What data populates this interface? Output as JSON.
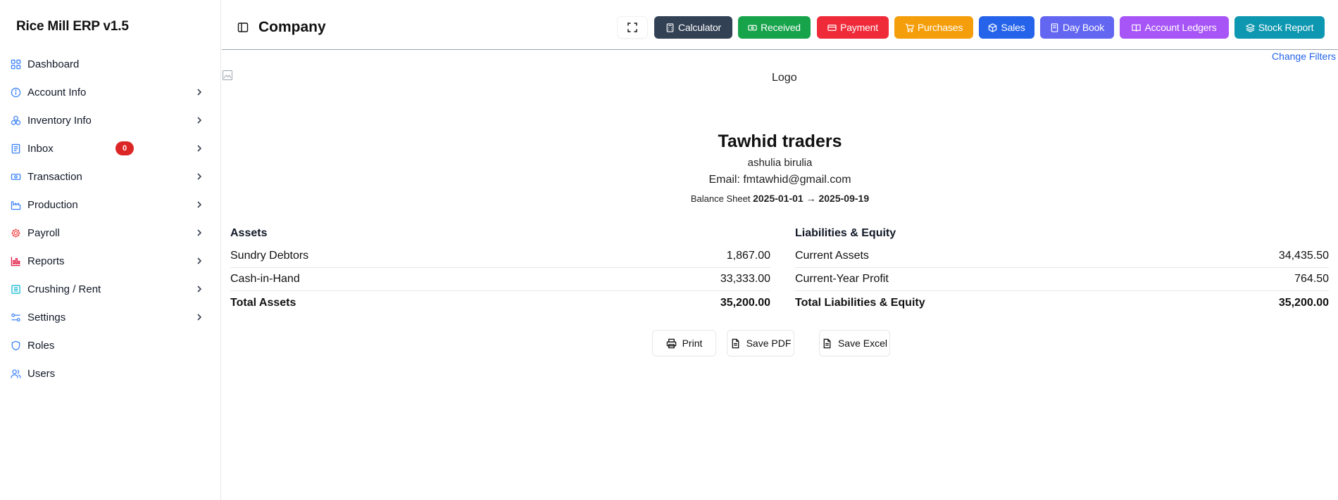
{
  "sidebar": {
    "brand": "Rice Mill ERP v1.5",
    "items": [
      {
        "label": "Dashboard",
        "icon": "grid-icon",
        "color": "#3b82f6"
      },
      {
        "label": "Account Info",
        "icon": "info-icon",
        "color": "#3b82f6"
      },
      {
        "label": "Inventory Info",
        "icon": "boxes-icon",
        "color": "#3b82f6"
      },
      {
        "label": "Inbox",
        "icon": "document-icon",
        "color": "#3b82f6",
        "badge": "0"
      },
      {
        "label": "Transaction",
        "icon": "cash-icon",
        "color": "#3b82f6"
      },
      {
        "label": "Production",
        "icon": "factory-icon",
        "color": "#3b82f6"
      },
      {
        "label": "Payroll",
        "icon": "gear-icon",
        "color": "#ef4444"
      },
      {
        "label": "Reports",
        "icon": "bar-chart-icon",
        "color": "#e11d48"
      },
      {
        "label": "Crushing / Rent",
        "icon": "building-icon",
        "color": "#06b6d4"
      },
      {
        "label": "Settings",
        "icon": "sliders-icon",
        "color": "#3b82f6"
      },
      {
        "label": "Roles",
        "icon": "shield-icon",
        "color": "#3b82f6"
      },
      {
        "label": "Users",
        "icon": "users-icon",
        "color": "#3b82f6"
      }
    ]
  },
  "header": {
    "title": "Company",
    "buttons": [
      {
        "label": "Calculator",
        "color": "#334155",
        "icon": "calculator-icon"
      },
      {
        "label": "Received",
        "color": "#16a34a",
        "icon": "banknote-icon"
      },
      {
        "label": "Payment",
        "color": "#ef2b3a",
        "icon": "credit-card-icon"
      },
      {
        "label": "Purchases",
        "color": "#f59e0b",
        "icon": "cart-icon"
      },
      {
        "label": "Sales",
        "color": "#2563eb",
        "icon": "package-icon"
      },
      {
        "label": "Day Book",
        "color": "#6366f1",
        "icon": "book-icon"
      },
      {
        "label": "Account Ledgers",
        "color": "#a855f7",
        "icon": "open-book-icon"
      },
      {
        "label": "Stock Report",
        "color": "#0e97b0",
        "icon": "layers-icon"
      }
    ]
  },
  "filters": {
    "change_label": "Change Filters"
  },
  "report": {
    "logo_alt": "Logo",
    "company_name": "Tawhid traders",
    "address": "ashulia birulia",
    "email_line": "Email: fmtawhid@gmail.com",
    "report_name": "Balance Sheet",
    "date_range": "2025-01-01 → 2025-09-19",
    "assets": {
      "heading": "Assets",
      "rows": [
        {
          "label": "Sundry Debtors",
          "value": "1,867.00"
        },
        {
          "label": "Cash-in-Hand",
          "value": "33,333.00"
        }
      ],
      "total_label": "Total Assets",
      "total_value": "35,200.00"
    },
    "liabilities": {
      "heading": "Liabilities & Equity",
      "rows": [
        {
          "label": "Current Assets",
          "value": "34,435.50"
        },
        {
          "label": "Current-Year Profit",
          "value": "764.50"
        }
      ],
      "total_label": "Total Liabilities & Equity",
      "total_value": "35,200.00"
    }
  },
  "actions": {
    "print": "Print",
    "save_pdf": "Save PDF",
    "save_excel": "Save Excel"
  }
}
